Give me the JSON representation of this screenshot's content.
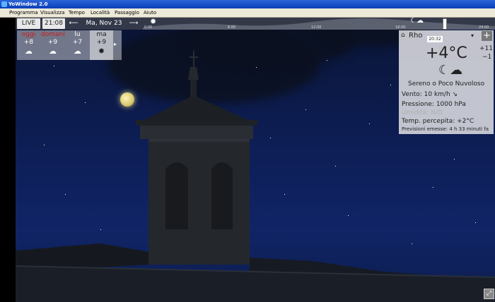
{
  "window": {
    "title": "YoWindow 2.0"
  },
  "menu": [
    "Programma",
    "Visualizza",
    "Tempo",
    "Località",
    "Passaggio",
    "Aiuto"
  ],
  "topbar": {
    "live": "LIVE",
    "time": "21:08",
    "prev_arrow": "⟵",
    "date": "Ma, Nov 23",
    "next_arrow": "⟶",
    "timeline": [
      "0:00",
      "6:00",
      "12:00",
      "18:00",
      "24:00"
    ]
  },
  "forecast": [
    {
      "name": "oggi",
      "temp": "+8",
      "icon": "rain-cloud-icon",
      "glyph": "☁",
      "highlight": true
    },
    {
      "name": "domani",
      "temp": "+9",
      "icon": "rain-cloud-icon",
      "glyph": "☁",
      "highlight": true
    },
    {
      "name": "lu",
      "temp": "+7",
      "icon": "rain-cloud-icon",
      "glyph": "☁",
      "highlight": false
    },
    {
      "name": "ma",
      "temp": "+9",
      "icon": "sun-icon",
      "glyph": "✹",
      "highlight": false
    }
  ],
  "forecast_more": "▸",
  "panel": {
    "city": "Rho",
    "local_time": "20:32",
    "dropdown": "▾",
    "plus": "+",
    "temp": "+4°C",
    "high": "+11",
    "low": "−1",
    "icon_glyph": "☾☁",
    "condition": "Sereno o Poco Nuvoloso",
    "wind": "Vento:  10 km/h  ↘",
    "pressure": "Pressione:  1000 hPa",
    "humidity": "Umidità:  N/D",
    "feels": "Temp. percepita:  +2°C",
    "issued": "Previsioni emesse:  4 h 33 minuti fa"
  },
  "colors": {
    "accent_red": "#c81a1a",
    "title_blue": "#0a3fb8"
  }
}
